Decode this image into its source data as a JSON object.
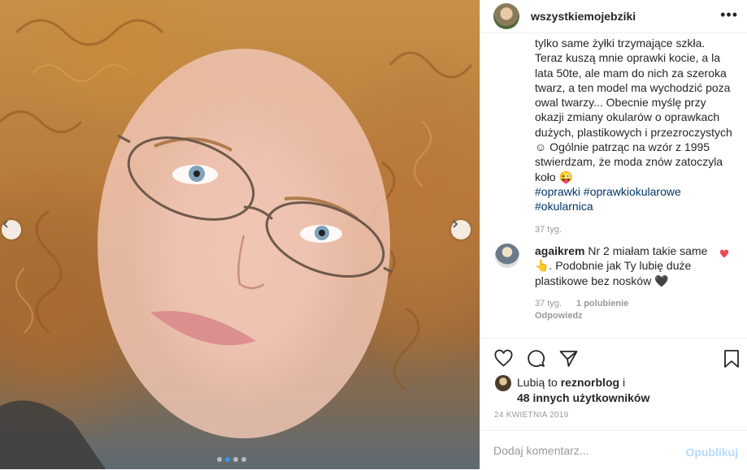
{
  "post": {
    "username": "wszystkiemojebziki",
    "caption_lines": [
      "tylko same żyłki trzymające szkła.",
      "Teraz kuszą mnie oprawki kocie, a la",
      "lata 50te, ale mam do nich za szeroka",
      "twarz, a ten model ma wychodzić poza",
      "owal twarzy... Obecnie myślę przy",
      "okazji zmiany okularów o oprawkach",
      "dużych, plastikowych i przezroczystych",
      "☺ Ogólnie patrząc na wzór z 1995",
      "stwierdzam, że moda znów zatoczyla",
      "koło 😜"
    ],
    "hashtags_line1": "#oprawki #oprawkiokularowe",
    "hashtags_line2": "#okularnica",
    "caption_time": "37 tyg."
  },
  "comment": {
    "username": "agaikrem",
    "text_line1": " Nr 2 miałam takie same",
    "text_line2": "👆. Podobnie jak Ty lubię duże",
    "text_line3": "plastikowe bez nosków 🖤",
    "time": "37 tyg.",
    "likes": "1 polubienie",
    "reply": "Odpowiedz"
  },
  "likes": {
    "prefix": "Lubią to ",
    "user": "reznorblog",
    "suffix": " i",
    "others": "48 innych użytkowników"
  },
  "date": "24 KWIETNIA 2019",
  "comment_box": {
    "placeholder": "Dodaj komentarz...",
    "publish": "Opublikuj"
  },
  "icons": {
    "more": "more-icon",
    "heart": "heart-icon",
    "comment": "comment-icon",
    "share": "share-icon",
    "bookmark": "bookmark-icon"
  },
  "colors": {
    "accent": "#3897f0",
    "liked_heart": "#ed4956",
    "hashtag": "#003569",
    "publish_disabled": "#b3dbff"
  },
  "carousel": {
    "dot_count": 4,
    "active_index": 1
  }
}
